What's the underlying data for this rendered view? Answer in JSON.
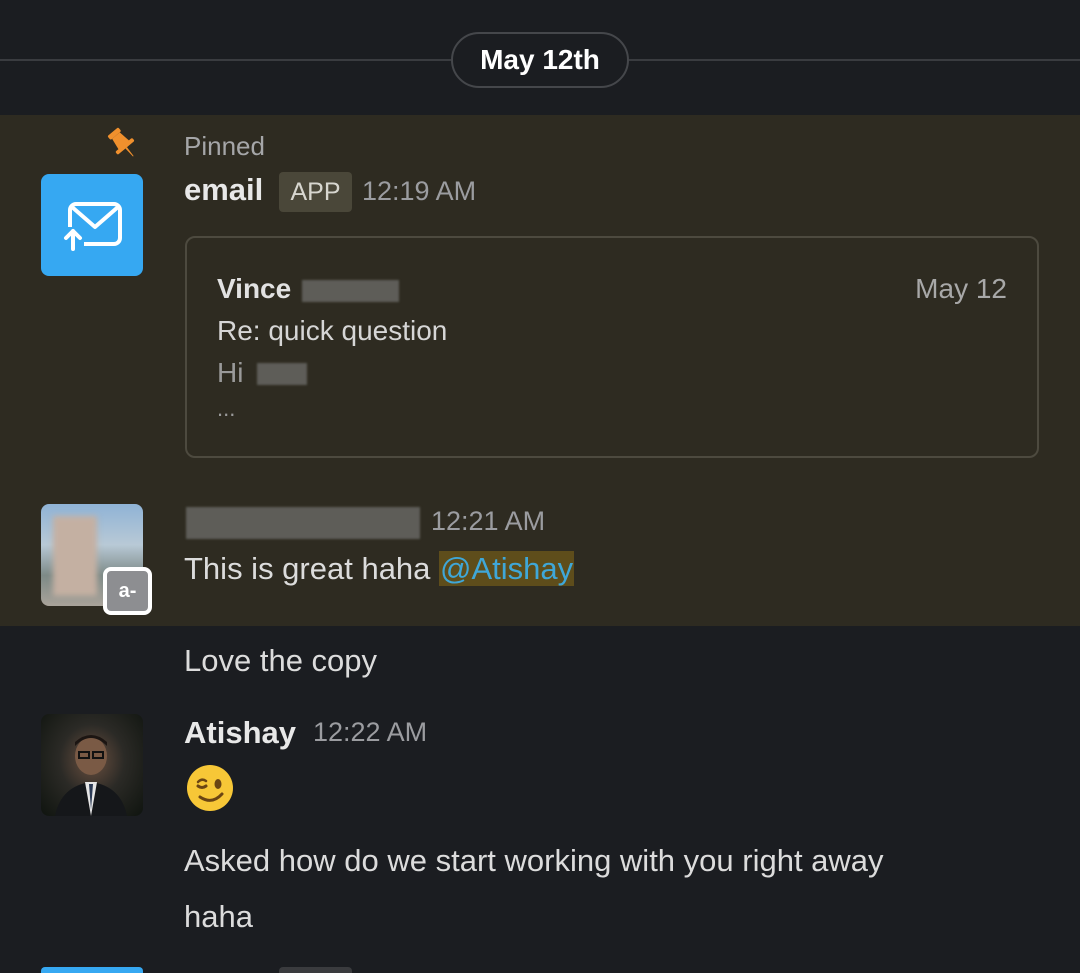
{
  "date_divider": {
    "label": "May 12th"
  },
  "pinned_message": {
    "pinned_label": "Pinned",
    "sender": "email",
    "app_badge": "APP",
    "time": "12:19 AM",
    "email_card": {
      "from": "Vince",
      "date": "May 12",
      "subject": "Re: quick question",
      "preview": "Hi",
      "ellipsis": "..."
    }
  },
  "highlighted_message": {
    "time": "12:21 AM",
    "status_badge": "a-",
    "text_before_mention": "This is great haha ",
    "mention": "@Atishay"
  },
  "follow_up_message": {
    "text": "Love the copy"
  },
  "atishay_message": {
    "sender": "Atishay",
    "time": "12:22 AM",
    "emoji": "winking-face",
    "text": "Asked how do we start working with you right away",
    "text_cont": "haha"
  },
  "colors": {
    "background": "#1b1d21",
    "pinned_highlight": "#2e2b21",
    "email_app_blue": "#36a8f2",
    "mention_text": "#3fa7d8",
    "mention_bg": "#5e4d1b",
    "pin_orange": "#f0902d"
  }
}
